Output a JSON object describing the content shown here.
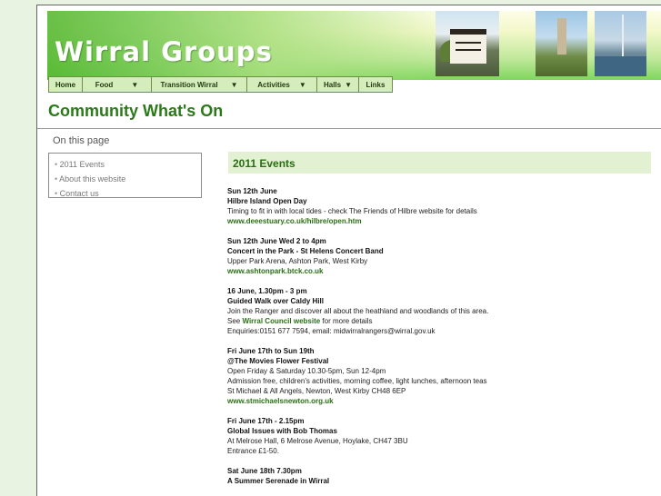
{
  "site": {
    "title": "Wirral Groups"
  },
  "nav": [
    {
      "label": "Home",
      "dropdown": false
    },
    {
      "label": "Food",
      "dropdown": true
    },
    {
      "label": "Transition Wirral",
      "dropdown": true
    },
    {
      "label": "Activities",
      "dropdown": true
    },
    {
      "label": "Halls",
      "dropdown": true
    },
    {
      "label": "Links",
      "dropdown": false
    }
  ],
  "page": {
    "heading": "Community What's On",
    "on_this_page": "On this page"
  },
  "toc": [
    {
      "label": "2011 Events"
    },
    {
      "label": "About this website"
    },
    {
      "label": "Contact us"
    }
  ],
  "section": {
    "title": "2011 Events"
  },
  "events": [
    {
      "date": "Sun 12th June",
      "name": "Hilbre Island Open Day",
      "lines": [
        "Timing to fit in with local tides - check The Friends of Hilbre website for details"
      ],
      "link": "www.deeestuary.co.uk/hilbre/open.htm"
    },
    {
      "date": "Sun 12th June Wed 2 to 4pm",
      "name": "Concert in the Park - St Helens Concert Band",
      "lines": [
        "Upper Park Arena, Ashton Park, West Kirby"
      ],
      "link": "www.ashtonpark.btck.co.uk"
    },
    {
      "date": "16 June, 1.30pm - 3 pm",
      "name": "Guided Walk over Caldy Hill",
      "lines": [
        "Join the Ranger and discover all about the heathland and woodlands of this area."
      ],
      "see_prefix": "See ",
      "see_link": "Wirral Council website",
      "see_suffix": " for more details",
      "lines2": [
        "Enquiries:0151 677 7594, email: midwirralrangers@wirral.gov.uk"
      ]
    },
    {
      "date": "Fri June 17th to Sun 19th",
      "name": "@The Movies Flower Festival",
      "lines": [
        "Open Friday & Saturday 10.30-5pm, Sun 12-4pm",
        "Admission free, children's activities, morning coffee, light lunches, afternoon teas",
        "St Michael & All Angels, Newton, West Kirby CH48 6EP"
      ],
      "link": "www.stmichaelsnewton.org.uk"
    },
    {
      "date": "Fri June 17th - 2.15pm",
      "name": "Global Issues with Bob Thomas",
      "lines": [
        "At Melrose Hall, 6 Melrose Avenue, Hoylake, CH47 3BU",
        "Entrance £1-50."
      ]
    },
    {
      "date": "Sat June 18th 7.30pm",
      "name": "A Summer Serenade in Wirral",
      "lines": []
    }
  ]
}
